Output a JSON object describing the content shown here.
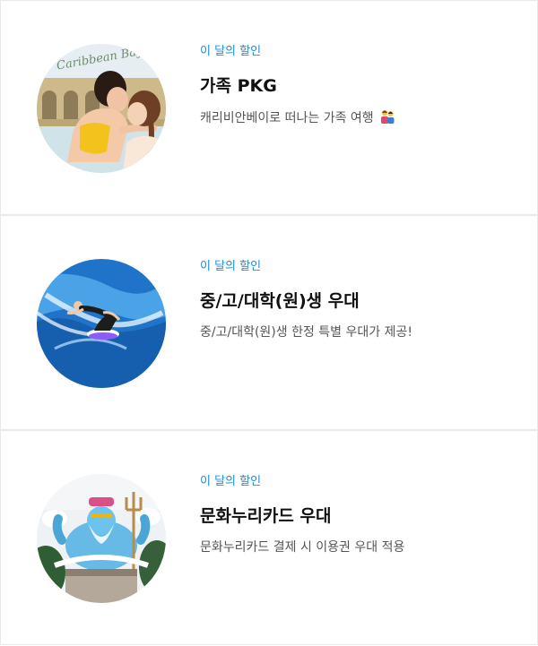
{
  "promos": [
    {
      "badge": "이 달의 할인",
      "title": "가족 PKG",
      "description": "캐리비안베이로 떠나는 가족 여행",
      "image_sign": "Caribbean Bay",
      "emoji": "family-emoji"
    },
    {
      "badge": "이 달의 할인",
      "title": "중/고/대학(원)생 우대",
      "description": "중/고/대학(원)생 한정 특별 우대가 제공!"
    },
    {
      "badge": "이 달의 할인",
      "title": "문화누리카드 우대",
      "description": "문화누리카드 결제 시 이용권 우대 적용"
    }
  ]
}
